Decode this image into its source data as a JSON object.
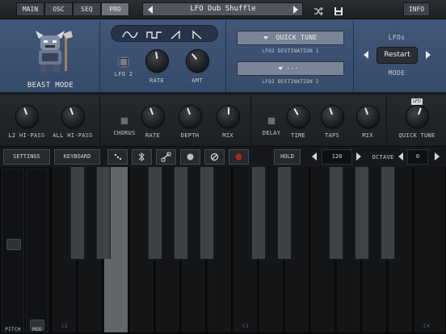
{
  "topbar": {
    "tabs": [
      "MAIN",
      "OSC",
      "SEQ",
      "PRO"
    ],
    "selected_tab": "PRO",
    "preset_name": "LFO Dub Shuffle",
    "info_label": "INFO"
  },
  "lfo": {
    "character_label": "BEAST MODE",
    "waveforms": [
      "sine",
      "square",
      "saw-up",
      "saw-down"
    ],
    "lfo2_label": "LFO 2",
    "rate_label": "RATE",
    "amt_label": "AMT",
    "dest1_value": "QUICK TUNE",
    "dest1_label": "LFO2 DESTINATION 1",
    "dest2_value": "---",
    "dest2_label": "LFO2 DESTINATION 2",
    "lfos_label": "LFOs",
    "restart_label": "Restart",
    "mode_label": "MODE"
  },
  "effects": {
    "l2_hipass_label": "L2 HI-PASS",
    "all_hipass_label": "ALL HI-PASS",
    "chorus_label": "CHORUS",
    "chorus_rate_label": "RATE",
    "chorus_depth_label": "DEPTH",
    "chorus_mix_label": "MIX",
    "delay_label": "DELAY",
    "delay_time_label": "TIME",
    "delay_taps_label": "TAPS",
    "delay_mix_label": "MIX",
    "quick_tune_label": "QUICK TUNE",
    "lfo_badge": "LFO"
  },
  "bottombar": {
    "settings_label": "SETTINGS",
    "keyboard_label": "KEYBOARD",
    "hold_label": "HOLD",
    "tempo_value": "120",
    "octave_label": "OCTAVE",
    "octave_value": "0"
  },
  "keyboard": {
    "pitch_label": "PITCH",
    "mod_label": "MOD",
    "octave_labels": [
      "C2",
      "C3",
      "C4"
    ],
    "pressed_key": "E2"
  },
  "colors": {
    "panel_blue": "#3d5272",
    "panel_dark": "#1c1e22",
    "knob": "#202226",
    "keys_white": "#131517",
    "keys_black": "#3e4145",
    "pressed": "#62666b"
  }
}
